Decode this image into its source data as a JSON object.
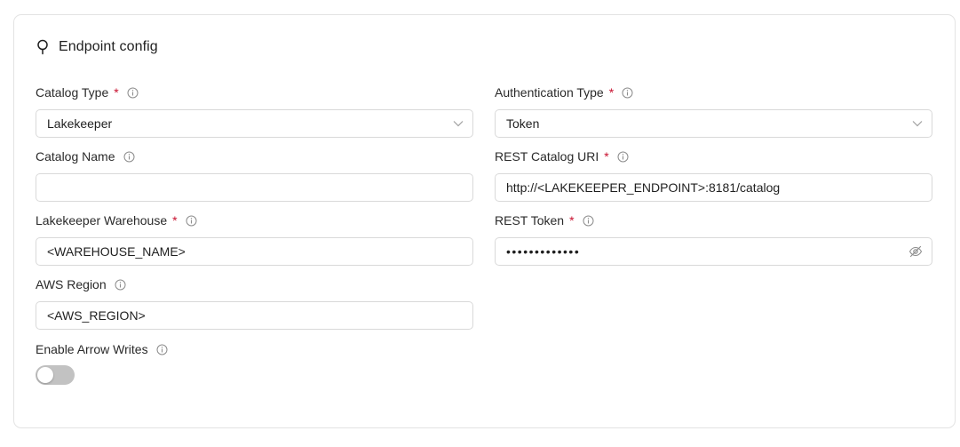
{
  "card": {
    "title": "Endpoint config",
    "icon": "lightbulb-icon"
  },
  "fields": {
    "catalog_type": {
      "label": "Catalog Type",
      "required": "*",
      "value": "Lakekeeper"
    },
    "authentication_type": {
      "label": "Authentication Type",
      "required": "*",
      "value": "Token"
    },
    "catalog_name": {
      "label": "Catalog Name",
      "value": ""
    },
    "rest_catalog_uri": {
      "label": "REST Catalog URI",
      "required": "*",
      "value": "http://<LAKEKEEPER_ENDPOINT>:8181/catalog"
    },
    "lakekeeper_warehouse": {
      "label": "Lakekeeper Warehouse",
      "required": "*",
      "value": "<WAREHOUSE_NAME>"
    },
    "rest_token": {
      "label": "REST Token",
      "required": "*",
      "value": "•••••••••••••"
    },
    "aws_region": {
      "label": "AWS Region",
      "value": "<AWS_REGION>"
    },
    "enable_arrow_writes": {
      "label": "Enable Arrow Writes",
      "enabled": false
    }
  },
  "colors": {
    "required": "#c8102e",
    "toggle_off": "#c2c2c2",
    "border": "#d9d9d9"
  }
}
